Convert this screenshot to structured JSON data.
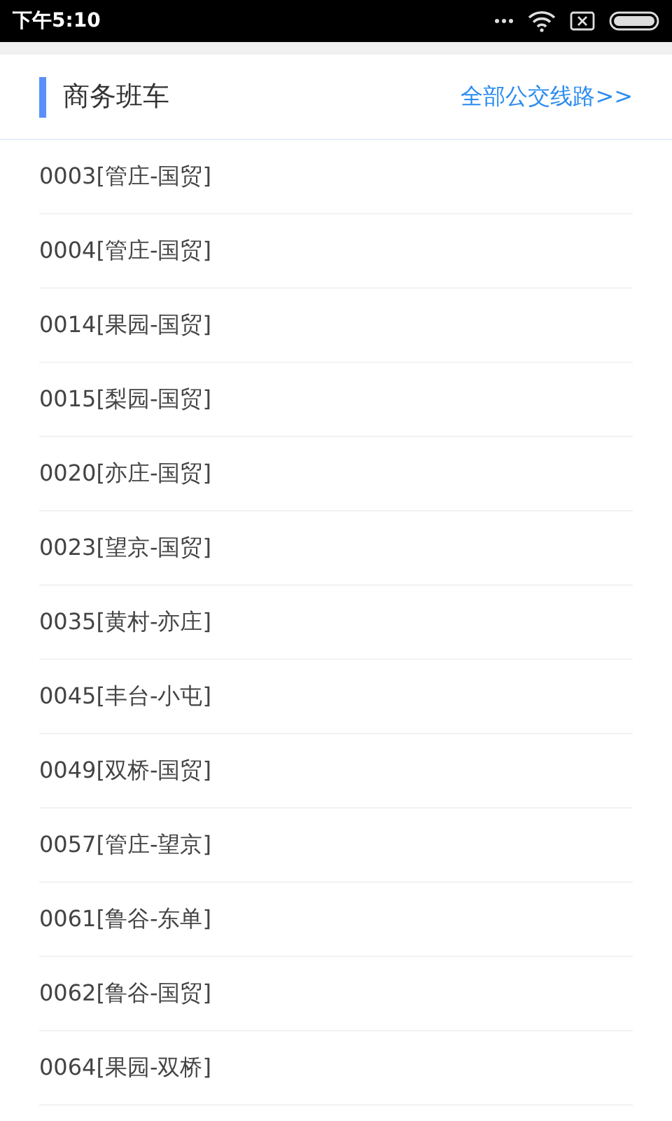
{
  "status_bar": {
    "time": "下午5:10"
  },
  "header": {
    "title": "商务班车",
    "link": "全部公交线路>>"
  },
  "routes": [
    {
      "label": "0003[管庄-国贸]"
    },
    {
      "label": "0004[管庄-国贸]"
    },
    {
      "label": "0014[果园-国贸]"
    },
    {
      "label": "0015[梨园-国贸]"
    },
    {
      "label": "0020[亦庄-国贸]"
    },
    {
      "label": "0023[望京-国贸]"
    },
    {
      "label": "0035[黄村-亦庄]"
    },
    {
      "label": "0045[丰台-小屯]"
    },
    {
      "label": "0049[双桥-国贸]"
    },
    {
      "label": "0057[管庄-望京]"
    },
    {
      "label": "0061[鲁谷-东单]"
    },
    {
      "label": "0062[鲁谷-国贸]"
    },
    {
      "label": "0064[果园-双桥]"
    }
  ]
}
